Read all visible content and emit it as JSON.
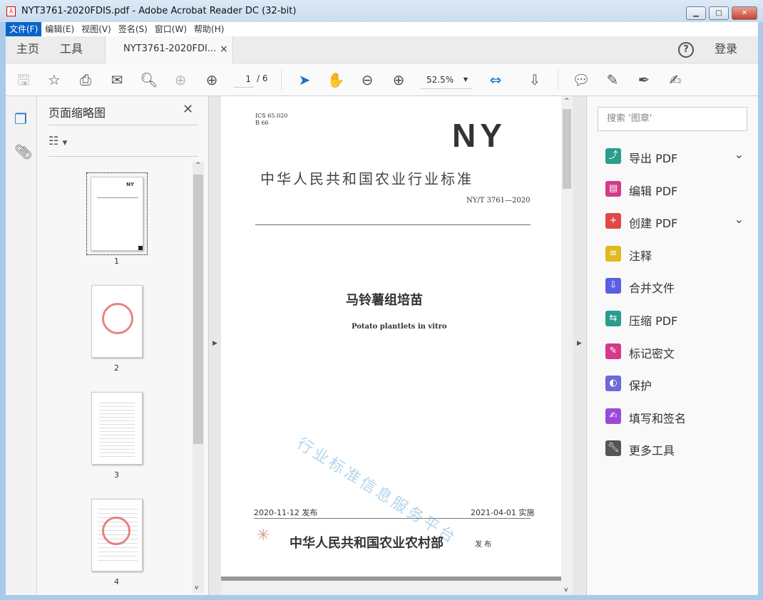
{
  "window": {
    "title": "NYT3761-2020FDIS.pdf - Adobe Acrobat Reader DC (32-bit)",
    "minimize": "▁",
    "maximize": "□",
    "close": "✕"
  },
  "menu": [
    "文件(F)",
    "编辑(E)",
    "视图(V)",
    "签名(S)",
    "窗口(W)",
    "帮助(H)"
  ],
  "tabs": {
    "home": "主页",
    "tools": "工具",
    "document": "NYT3761-2020FDI...",
    "close": "×",
    "help": "?",
    "login": "登录"
  },
  "toolbar": {
    "page_current": "1",
    "page_total": "/ 6",
    "zoom": "52.5%"
  },
  "thumbnails": {
    "title": "页面缩略图",
    "close": "✕",
    "pages": [
      "1",
      "2",
      "3",
      "4"
    ]
  },
  "document": {
    "ics": "ICS 65.020",
    "b": "B 66",
    "logo": "NY",
    "org_title": "中华人民共和国农业行业标准",
    "std_no": "NY/T 3761—2020",
    "title_cn": "马铃薯组培苗",
    "title_en": "Potato plantlets in vitro",
    "watermark": "行业标准信息服务平台",
    "issue_date": "2020-11-12 发布",
    "impl_date": "2021-04-01 实施",
    "publisher": "中华人民共和国农业农村部",
    "publish": "发 布"
  },
  "right_pane": {
    "search_placeholder": "搜索 '图章'",
    "tools": [
      {
        "label": "导出 PDF",
        "color": "#2a9d8f",
        "expand": true
      },
      {
        "label": "编辑 PDF",
        "color": "#d6398a",
        "expand": false
      },
      {
        "label": "创建 PDF",
        "color": "#e04848",
        "expand": true
      },
      {
        "label": "注释",
        "color": "#e0b820",
        "expand": false
      },
      {
        "label": "合并文件",
        "color": "#5a5ee0",
        "expand": false
      },
      {
        "label": "压缩 PDF",
        "color": "#2a9d8f",
        "expand": false
      },
      {
        "label": "标记密文",
        "color": "#d6398a",
        "expand": false
      },
      {
        "label": "保护",
        "color": "#6a6ad8",
        "expand": false
      },
      {
        "label": "填写和签名",
        "color": "#9a4ad8",
        "expand": false
      },
      {
        "label": "更多工具",
        "color": "#555555",
        "expand": false
      }
    ]
  }
}
